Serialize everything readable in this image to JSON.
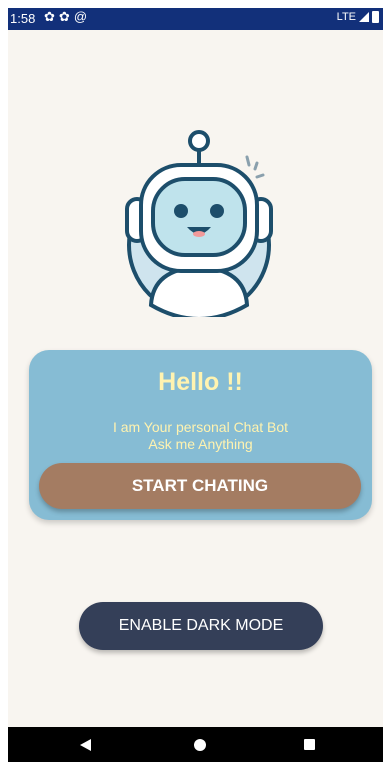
{
  "status_bar": {
    "time": "1:58",
    "left_icons": [
      "settings-icon",
      "settings-icon",
      "at-sign-icon"
    ],
    "network": "LTE",
    "right_icons": [
      "signal-icon",
      "battery-icon"
    ]
  },
  "greeting_card": {
    "title": "Hello !!",
    "subtitle_line1": "I am Your personal Chat Bot",
    "subtitle_line2": "Ask me Anything",
    "start_button_label": "START CHATING"
  },
  "dark_mode_button_label": "ENABLE DARK MODE",
  "nav_bar": {
    "icons": [
      "back-icon",
      "home-icon",
      "recents-icon"
    ]
  },
  "colors": {
    "status_bar": "#12307a",
    "background": "#f8f5f0",
    "card": "#86bcd4",
    "card_text": "#fff3b0",
    "start_button": "#a47c62",
    "dark_mode_button": "#343f58"
  }
}
